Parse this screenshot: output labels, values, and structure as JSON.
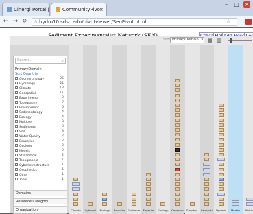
{
  "browser": {
    "tabs": [
      {
        "label": "Cinergi Portal | Hom",
        "active": false
      },
      {
        "label": "CommunityPivot",
        "active": true
      }
    ],
    "url": "hydro10.sdsc.edu/pivotviewer/SenPivot.html",
    "window_buttons": [
      "–",
      "□",
      "×"
    ]
  },
  "page": {
    "title": "Sediment Experimentalist Network (SEN)",
    "links": [
      "Contact",
      "Help",
      "Add Resource",
      "Login"
    ]
  },
  "toolbar": {
    "sort_label": "Sort:",
    "sort_value": "PrimaryDomain",
    "view_icons": [
      "grid-view-icon",
      "bar-view-icon"
    ]
  },
  "sidebar": {
    "search_placeholder": "Search...",
    "facet_heading": "PrimaryDomain",
    "facet_sub": "Sort Quantity",
    "items": [
      {
        "label": "Geomorphology",
        "count": "26"
      },
      {
        "label": "Hydrology",
        "count": "21"
      },
      {
        "label": "Climate",
        "count": "13"
      },
      {
        "label": "Geospatial",
        "count": "11"
      },
      {
        "label": "Experiments",
        "count": "9"
      },
      {
        "label": "Topography",
        "count": "7"
      },
      {
        "label": "Environment",
        "count": "6"
      },
      {
        "label": "Sedimentology",
        "count": "4"
      },
      {
        "label": "Ecology",
        "count": "4"
      },
      {
        "label": "Multiple",
        "count": "3"
      },
      {
        "label": "Sediments",
        "count": "3"
      },
      {
        "label": "Soil",
        "count": "3"
      },
      {
        "label": "Water Quality",
        "count": "2"
      },
      {
        "label": "Education",
        "count": "2"
      },
      {
        "label": "Geology",
        "count": "2"
      },
      {
        "label": "Models",
        "count": "2"
      },
      {
        "label": "Streamflow",
        "count": "2"
      },
      {
        "label": "Topographic",
        "count": "1"
      },
      {
        "label": "Cyberinfrastructure",
        "count": "1"
      },
      {
        "label": "Geophysics",
        "count": "1"
      },
      {
        "label": "Other",
        "count": "1"
      },
      {
        "label": "Tools",
        "count": "1"
      }
    ],
    "bottom": [
      "Domains",
      "Resource Category",
      "Organization"
    ]
  },
  "columns": [
    {
      "label": "Climate",
      "tiles": 6
    },
    {
      "label": "Cyberinf",
      "tiles": 1
    },
    {
      "label": "Ecology",
      "tiles": 3
    },
    {
      "label": "Educatio",
      "tiles": 1
    },
    {
      "label": "Environm",
      "tiles": 3
    },
    {
      "label": "Experim",
      "tiles": 7
    },
    {
      "label": "Geology",
      "tiles": 1
    },
    {
      "label": "Geomorp",
      "tiles": 26
    },
    {
      "label": "Geophys",
      "tiles": 1
    },
    {
      "label": "Geospati",
      "tiles": 11
    },
    {
      "label": "Hydrolo",
      "tiles": 21
    },
    {
      "label": "Models",
      "tiles": 2
    },
    {
      "label": "Multiple",
      "tiles": 2
    }
  ]
}
